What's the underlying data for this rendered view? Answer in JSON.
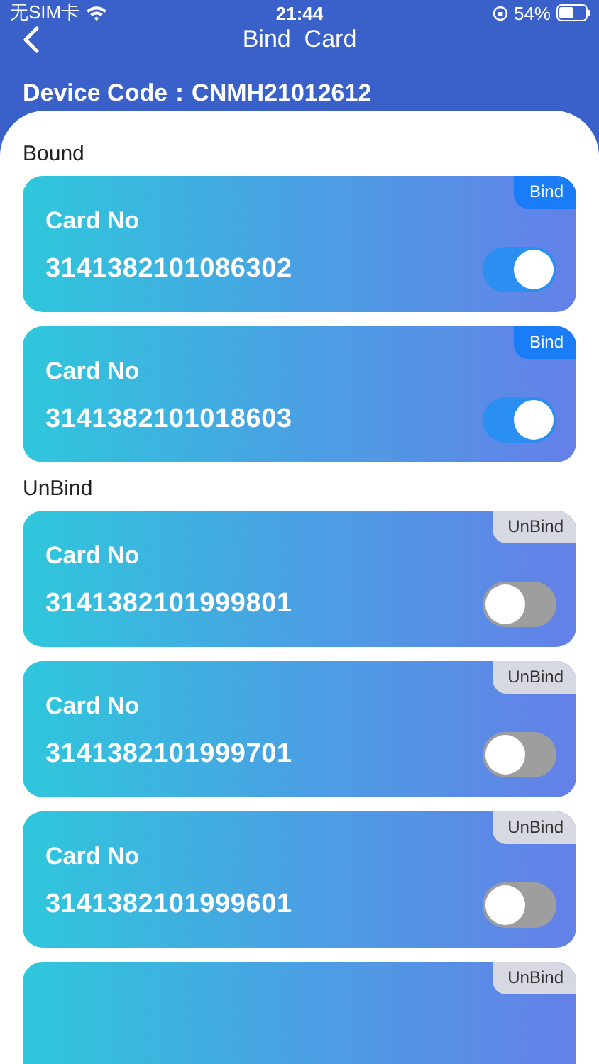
{
  "status_bar": {
    "carrier": "无SIM卡",
    "time": "21:44",
    "battery": "54%"
  },
  "nav": {
    "title": "Bind  Card"
  },
  "device": {
    "label": "Device Code：",
    "code": "CNMH21012612"
  },
  "sections": [
    {
      "title": "Bound",
      "cards": [
        {
          "label": "Card No",
          "number": "3141382101086302",
          "badge": {
            "text": "Bind",
            "kind": "bound"
          },
          "on": true
        },
        {
          "label": "Card No",
          "number": "3141382101018603",
          "badge": {
            "text": "Bind",
            "kind": "bound"
          },
          "on": true
        }
      ]
    },
    {
      "title": "UnBind",
      "cards": [
        {
          "label": "Card No",
          "number": "3141382101999801",
          "badge": {
            "text": "UnBind",
            "kind": "unbound"
          },
          "on": false
        },
        {
          "label": "Card No",
          "number": "3141382101999701",
          "badge": {
            "text": "UnBind",
            "kind": "unbound"
          },
          "on": false
        },
        {
          "label": "Card No",
          "number": "3141382101999601",
          "badge": {
            "text": "UnBind",
            "kind": "unbound"
          },
          "on": false
        },
        {
          "badge": {
            "text": "UnBind",
            "kind": "unbound"
          }
        }
      ]
    }
  ]
}
